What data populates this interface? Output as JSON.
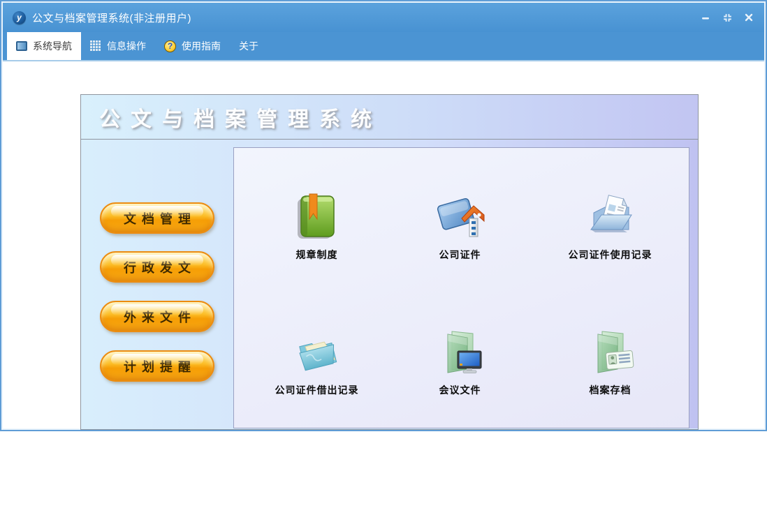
{
  "window": {
    "title": "公文与档案管理系统(非注册用户)",
    "app_logo_letter": "y"
  },
  "tabs": {
    "nav": {
      "label": "系统导航",
      "icon": "blue-square-icon",
      "active": true
    },
    "info": {
      "label": "信息操作",
      "icon": "grid-icon",
      "active": false
    },
    "guide": {
      "label": "使用指南",
      "icon": "help-question-icon",
      "badge_glyph": "?",
      "active": false
    },
    "about": {
      "label": "关于",
      "active": false
    }
  },
  "panel": {
    "header_title": "公文与档案管理系统",
    "sidebar_buttons": [
      {
        "label": "文档管理"
      },
      {
        "label": "行政发文"
      },
      {
        "label": "外来文件"
      },
      {
        "label": "计划提醒"
      }
    ],
    "shortcuts": [
      {
        "label": "规章制度",
        "icon": "green-book-icon"
      },
      {
        "label": "公司证件",
        "icon": "blue-folder-house-icon"
      },
      {
        "label": "公司证件使用记录",
        "icon": "open-folder-document-icon"
      },
      {
        "label": "公司证件借出记录",
        "icon": "teal-folder-paper-icon"
      },
      {
        "label": "会议文件",
        "icon": "green-folder-monitor-icon"
      },
      {
        "label": "档案存档",
        "icon": "green-folder-idcard-icon"
      }
    ]
  },
  "colors": {
    "titlebar_blue": "#4b94d3",
    "window_border": "#5f9dd6",
    "active_tab_bg": "#ffffff",
    "header_gradient_left": "#d9f0fc",
    "header_gradient_right": "#c2c5f2",
    "button_orange": "#f9a70f",
    "button_border": "#ec8c10",
    "button_text": "#3e2900",
    "inner_panel_bg": "#e9e9f8"
  }
}
